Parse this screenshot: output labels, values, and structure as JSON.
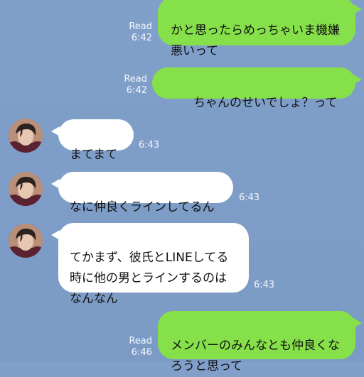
{
  "messages": [
    {
      "side": "me",
      "text": "かと思ったらめっちゃいま機嫌\n悪いって",
      "read": "Read",
      "time": "6:42"
    },
    {
      "side": "me",
      "text": "ちゃんのせいでしょ？って",
      "read": "Read",
      "time": "6:42"
    },
    {
      "side": "them",
      "text": "まてまて",
      "time": "6:43"
    },
    {
      "side": "them",
      "text": "なに仲良くラインしてるん",
      "time": "6:43"
    },
    {
      "side": "them",
      "text": "てかまず、彼氏とLINEしてる\n時に他の男とラインするのは\nなんなん",
      "time": "6:43"
    },
    {
      "side": "me",
      "text": "メンバーのみんなとも仲良くな\nろうと思って",
      "read": "Read",
      "time": "6:46"
    }
  ],
  "icons": {
    "avatar": "user-avatar-photo"
  },
  "colors": {
    "background": "#7f9ec8",
    "sent_bubble": "#86e04a",
    "received_bubble": "#ffffff"
  }
}
